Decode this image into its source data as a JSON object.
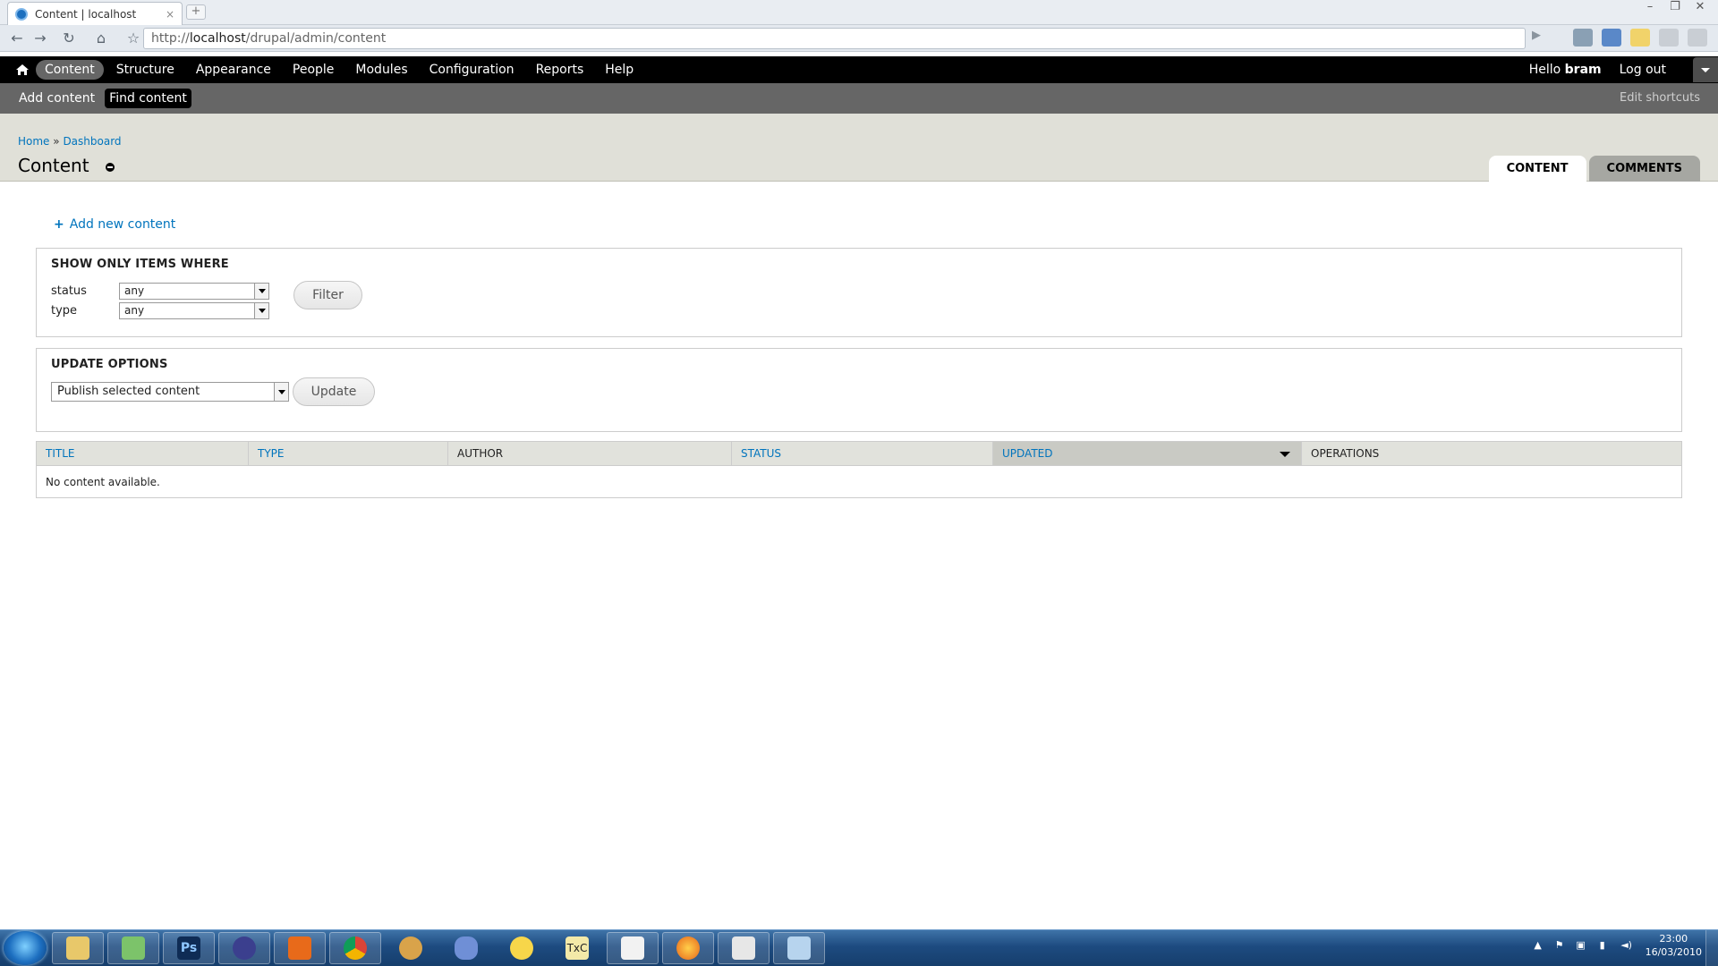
{
  "browser": {
    "tab_title": "Content | localhost",
    "tab_close": "×",
    "new_tab": "+",
    "url_prefix": "http://",
    "url_host": "localhost",
    "url_path": "/drupal/admin/content",
    "go": "▶",
    "window_controls": [
      "–",
      "❐",
      "✕"
    ]
  },
  "toolbar": {
    "menu": [
      "Content",
      "Structure",
      "Appearance",
      "People",
      "Modules",
      "Configuration",
      "Reports",
      "Help"
    ],
    "active_menu": "Content",
    "hello": "Hello",
    "username": "bram",
    "logout": "Log out",
    "shortcuts": [
      "Add content",
      "Find content"
    ],
    "active_shortcut": "Find content",
    "edit_shortcuts": "Edit shortcuts"
  },
  "branding": {
    "breadcrumb": [
      "Home",
      "Dashboard"
    ],
    "breadcrumb_sep": "»",
    "page_title": "Content",
    "tabs": [
      "CONTENT",
      "COMMENTS"
    ],
    "active_tab": "CONTENT"
  },
  "content": {
    "add_new_plus": "+",
    "add_new": "Add new content",
    "filter": {
      "legend": "SHOW ONLY ITEMS WHERE",
      "status_label": "status",
      "status_value": "any",
      "type_label": "type",
      "type_value": "any",
      "button": "Filter"
    },
    "update": {
      "legend": "UPDATE OPTIONS",
      "selected_option": "Publish selected content",
      "button": "Update"
    },
    "table": {
      "columns": [
        "TITLE",
        "TYPE",
        "AUTHOR",
        "STATUS",
        "UPDATED",
        "OPERATIONS"
      ],
      "sorted_column": "UPDATED",
      "empty_text": "No content available."
    }
  },
  "taskbar": {
    "apps": [
      "start-orb",
      "windows-explorer",
      "people-app",
      "photoshop",
      "eclipse",
      "xampp",
      "chrome",
      "app-7",
      "app-8",
      "lightbulb-app",
      "texniccenter",
      "notepad",
      "firefox",
      "java",
      "paint"
    ],
    "tray_icons": [
      "▲",
      "⚑",
      "▣",
      "▮",
      "◄)"
    ],
    "time": "23:00",
    "date": "16/03/2010"
  }
}
